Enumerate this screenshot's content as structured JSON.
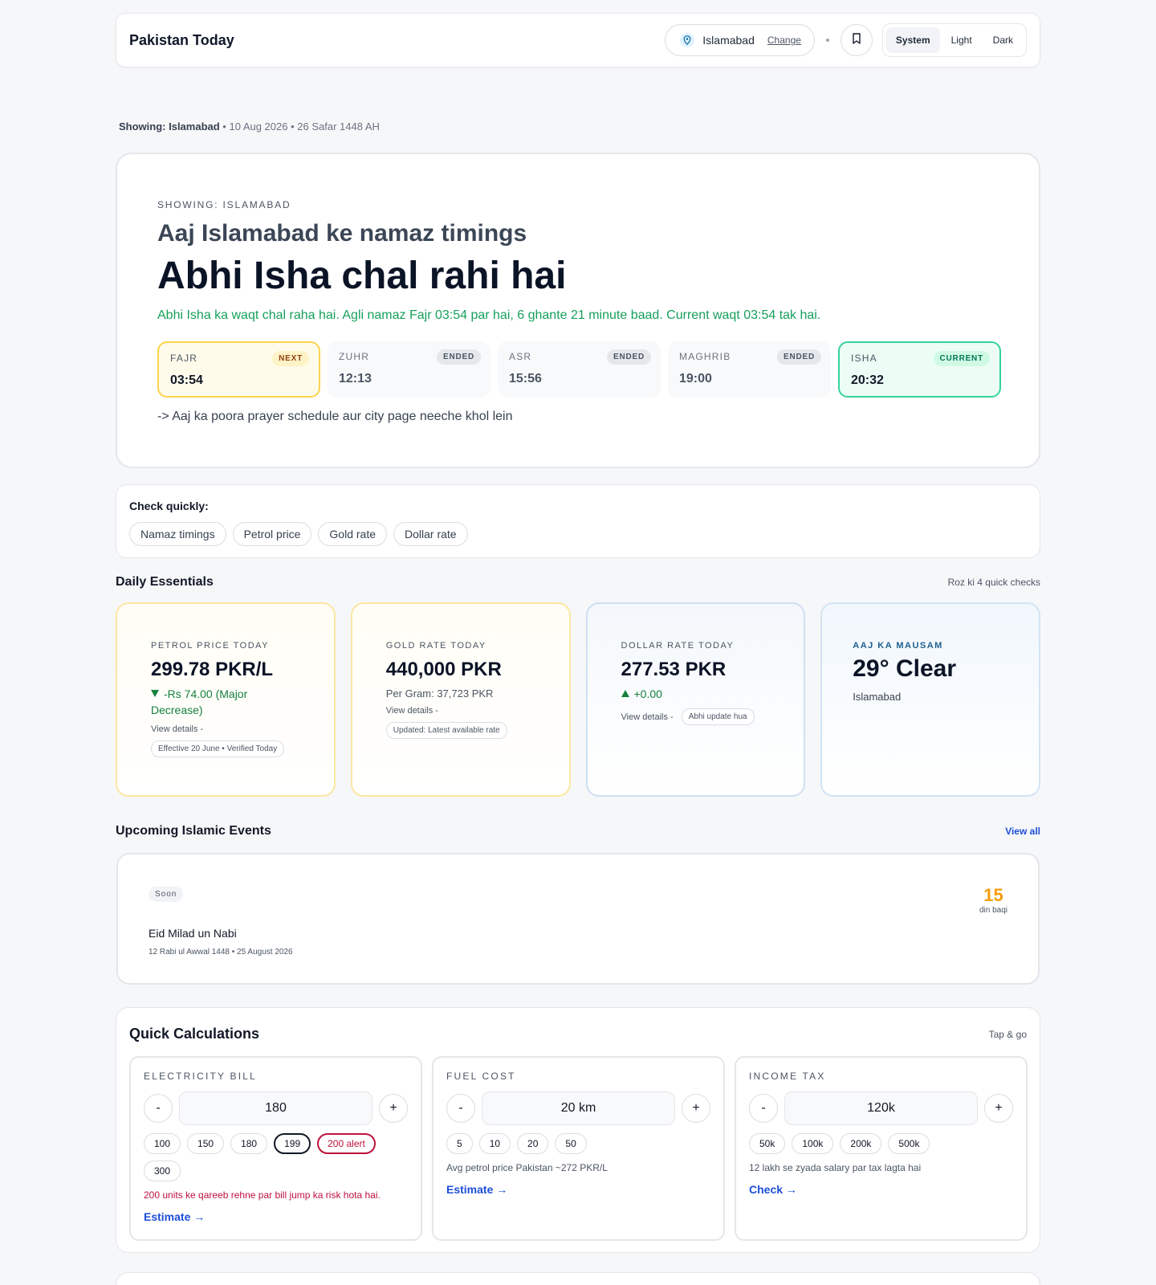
{
  "header": {
    "brand": "Pakistan Today",
    "location": "Islamabad",
    "change_label": "Change",
    "theme_options": [
      "System",
      "Light",
      "Dark"
    ],
    "theme_active": "System"
  },
  "showing": {
    "label": "Showing: Islamabad",
    "date_line": " • 10 Aug 2026 • 26 Safar 1448 AH"
  },
  "hero": {
    "eyebrow": "SHOWING: ISLAMABAD",
    "subtitle": "Aaj Islamabad ke namaz timings",
    "title": "Abhi Isha chal rahi hai",
    "description": "Abhi Isha ka waqt chal raha hai. Agli namaz Fajr 03:54 par hai, 6 ghante 21 minute baad. Current waqt 03:54 tak hai.",
    "prayers": [
      {
        "name": "FAJR",
        "time": "03:54",
        "badge": "NEXT",
        "state": "next"
      },
      {
        "name": "ZUHR",
        "time": "12:13",
        "badge": "ENDED",
        "state": "ended"
      },
      {
        "name": "ASR",
        "time": "15:56",
        "badge": "ENDED",
        "state": "ended"
      },
      {
        "name": "MAGHRIB",
        "time": "19:00",
        "badge": "ENDED",
        "state": "ended"
      },
      {
        "name": "ISHA",
        "time": "20:32",
        "badge": "CURRENT",
        "state": "current"
      }
    ],
    "link": "-> Aaj ka poora prayer schedule aur city page neeche khol lein"
  },
  "quick_check": {
    "label": "Check quickly:",
    "chips": [
      "Namaz timings",
      "Petrol price",
      "Gold rate",
      "Dollar rate"
    ]
  },
  "essentials": {
    "title": "Daily Essentials",
    "aside": "Roz ki 4 quick checks",
    "petrol": {
      "eyebrow": "PETROL PRICE TODAY",
      "value": "299.78 PKR/L",
      "change": "-Rs 74.00 (Major Decrease)",
      "details": "View details -",
      "tag": "Effective 20 June • Verified Today"
    },
    "gold": {
      "eyebrow": "GOLD RATE TODAY",
      "value": "440,000 PKR",
      "sub": "Per Gram: 37,723 PKR",
      "details": "View details -",
      "tag": "Updated: Latest available rate"
    },
    "dollar": {
      "eyebrow": "DOLLAR RATE TODAY",
      "value": "277.53 PKR",
      "change": "+0.00",
      "details": "View details -",
      "tag": "Abhi update hua"
    },
    "weather": {
      "eyebrow": "AAJ KA MAUSAM",
      "value": "29° Clear",
      "sub": "Islamabad"
    }
  },
  "events": {
    "title": "Upcoming Islamic Events",
    "view_all": "View all",
    "item": {
      "badge": "Soon",
      "name": "Eid Milad un Nabi",
      "date": "12 Rabi ul Awwal 1448  •  25 August 2026",
      "days": "15",
      "days_label": "din baqi"
    }
  },
  "calculations": {
    "title": "Quick Calculations",
    "aside": "Tap & go",
    "electricity": {
      "eyebrow": "ELECTRICITY BILL",
      "value": "180",
      "presets": [
        "100",
        "150",
        "180",
        "199",
        "200 alert",
        "300"
      ],
      "note": "200 units ke qareeb rehne par bill jump ka risk hota hai.",
      "link": "Estimate →"
    },
    "fuel": {
      "eyebrow": "FUEL COST",
      "value": "20 km",
      "presets": [
        "5",
        "10",
        "20",
        "50"
      ],
      "note": "Avg petrol price Pakistan ~272 PKR/L",
      "link": "Estimate →"
    },
    "tax": {
      "eyebrow": "INCOME TAX",
      "value": "120k",
      "presets": [
        "50k",
        "100k",
        "200k",
        "500k"
      ],
      "note": "12 lakh se zyada salary par tax lagta hai",
      "link": "Check →"
    },
    "minus": "-",
    "plus": "+"
  }
}
